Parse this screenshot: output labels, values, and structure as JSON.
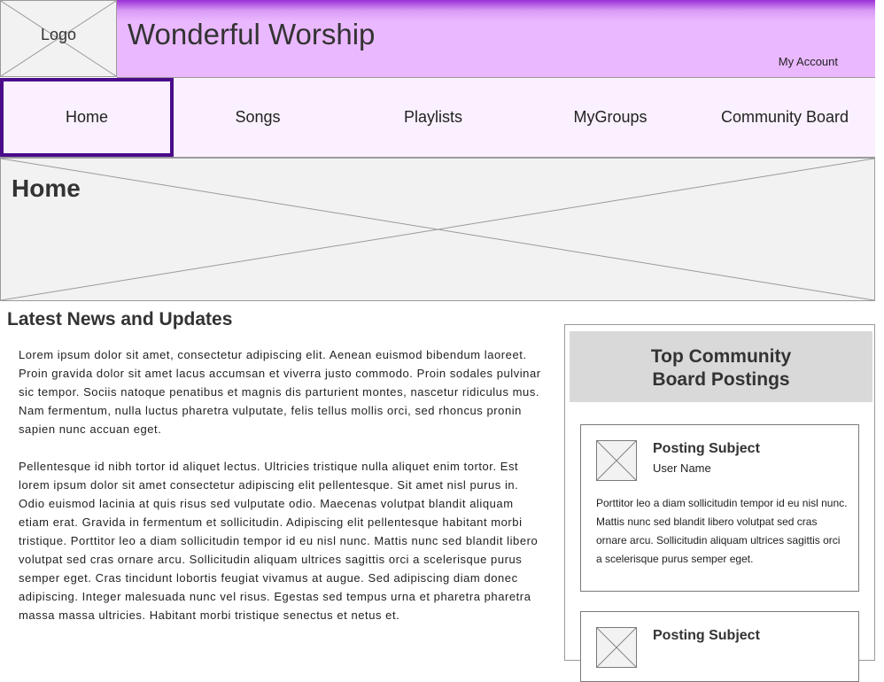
{
  "header": {
    "logo_label": "Logo",
    "site_title": "Wonderful Worship",
    "my_account": "My Account"
  },
  "nav": {
    "items": [
      {
        "label": "Home",
        "active": true
      },
      {
        "label": "Songs"
      },
      {
        "label": "Playlists"
      },
      {
        "label": "MyGroups"
      },
      {
        "label": "Community Board"
      }
    ]
  },
  "hero": {
    "title": "Home",
    "image": "image-placeholder"
  },
  "news": {
    "heading": "Latest News and Updates",
    "paragraphs": [
      "Lorem ipsum dolor sit amet, consectetur adipiscing elit. Aenean euismod bibendum laoreet. Proin gravida dolor sit amet lacus accumsan et viverra justo commodo. Proin sodales pulvinar sic tempor. Sociis natoque penatibus et magnis dis parturient montes, nascetur ridiculus mus. Nam fermentum, nulla luctus pharetra vulputate, felis tellus mollis orci, sed rhoncus pronin sapien nunc accuan eget.",
      "Pellentesque id nibh tortor id aliquet lectus. Ultricies tristique nulla aliquet enim tortor. Est lorem ipsum dolor sit amet consectetur adipiscing elit pellentesque. Sit amet nisl purus in. Odio euismod lacinia at quis risus sed vulputate odio. Maecenas volutpat blandit aliquam etiam erat. Gravida in fermentum et sollicitudin. Adipiscing elit pellentesque habitant morbi tristique. Porttitor leo a diam sollicitudin tempor id eu nisl nunc. Mattis nunc sed blandit libero volutpat sed cras ornare arcu. Sollicitudin aliquam ultrices sagittis orci a scelerisque purus semper eget. Cras tincidunt lobortis feugiat vivamus at augue. Sed adipiscing diam donec adipiscing. Integer malesuada nunc vel risus. Egestas sed tempus urna et pharetra pharetra massa massa ultricies. Habitant morbi tristique senectus et netus et."
    ]
  },
  "sidebar": {
    "title": "Top Community Board Postings",
    "posts": [
      {
        "subject": "Posting Subject",
        "user": "User Name",
        "body": "Porttitor leo a diam sollicitudin tempor id eu nisl nunc. Mattis nunc sed blandit libero volutpat sed cras ornare arcu. Sollicitudin aliquam ultrices sagittis orci a scelerisque purus semper eget."
      },
      {
        "subject": "Posting Subject"
      }
    ]
  },
  "colors": {
    "banner": "#eab8ff",
    "banner_top": "#9b2fd6",
    "nav_bg": "#fbf0ff",
    "nav_active_border": "#4b0a8a",
    "placeholder_bg": "#f2f2f2",
    "sidebar_head_bg": "#d9d9d9"
  }
}
